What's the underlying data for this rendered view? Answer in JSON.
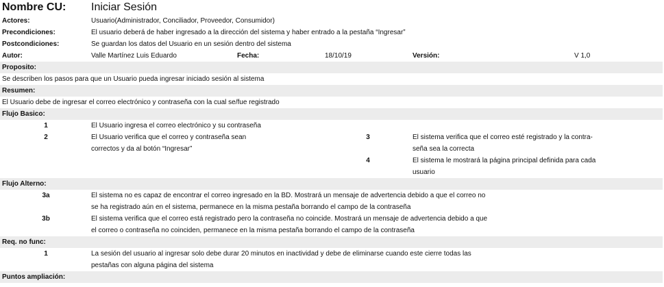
{
  "header": {
    "name_label": "Nombre CU:",
    "name_value": "Iniciar Sesión"
  },
  "actors": {
    "label": "Actores:",
    "value": "Usuario(Administrador, Conciliador, Proveedor, Consumidor)"
  },
  "preconditions": {
    "label": "Precondiciones:",
    "value": "El usuario deberá de haber ingresado a la dirección del sistema y haber entrado a la pestaña “Ingresar”"
  },
  "postconditions": {
    "label": "Postcondiciones:",
    "value": "Se guardan los datos del Usuario en un sesión dentro del sistema"
  },
  "meta": {
    "author_label": "Autor:",
    "author_value": "Valle Martínez Luis Eduardo",
    "date_label": "Fecha:",
    "date_value": "18/10/19",
    "version_label": "Versión:",
    "version_value": "V 1,0"
  },
  "purpose": {
    "label": "Proposito:",
    "text": "Se describen los pasos para que un Usuario pueda ingresar iniciado sesión al sistema"
  },
  "summary": {
    "label": "Resumen:",
    "text": "El Usuario debe de ingresar el correo electrónico y contraseña con la cual se/fue registrado"
  },
  "basic_flow": {
    "label": "Flujo Basico:",
    "steps": [
      {
        "num": "1",
        "lines": [
          "El Usuario ingresa el correo electrónico y su contraseña"
        ]
      },
      {
        "num": "2",
        "lines": [
          "El Usuario verifica que el correo y contraseña sean",
          "correctos y da al botón “Ingresar”"
        ]
      },
      {
        "num": "3",
        "lines": [
          "El sistema verifica que el correo esté registrado y la contra-",
          "seña sea la correcta"
        ]
      },
      {
        "num": "4",
        "lines": [
          "El sistema le mostrará la página principal definida para cada",
          "usuario"
        ]
      }
    ]
  },
  "alt_flow": {
    "label": "Flujo Alterno:",
    "steps": [
      {
        "num": "3a",
        "lines": [
          "El sistema no es capaz de encontrar el correo ingresado en la BD. Mostrará un mensaje de advertencia debido a que el correo no",
          "se ha registrado aún en el sistema, permanece en la misma pestaña borrando el campo de la contraseña"
        ]
      },
      {
        "num": "3b",
        "lines": [
          "El sistema verifica que el correo está registrado pero la contraseña no coincide. Mostrará un mensaje de advertencia debido a que",
          "el correo o contraseña no coinciden, permanece en la misma pestaña borrando el campo de la contraseña"
        ]
      }
    ]
  },
  "nonfunc": {
    "label": "Req. no func:",
    "steps": [
      {
        "num": "1",
        "lines": [
          "La sesión del usuario al ingresar solo debe durar 20 minutos en inactividad y debe de eliminarse cuando este cierre todas las",
          "pestañas con alguna página del sistema"
        ]
      }
    ]
  },
  "extension": {
    "label": "Puntos ampliación:"
  }
}
